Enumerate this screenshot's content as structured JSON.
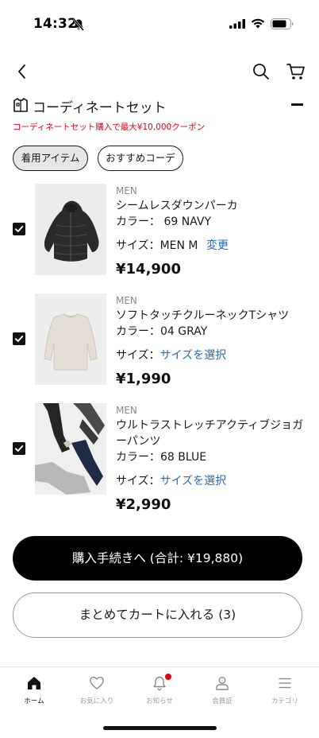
{
  "status_bar": {
    "time": "14:32"
  },
  "section": {
    "title": "コーディネートセット",
    "coupon_note": "コーディネートセット購入で最大¥10,000クーポン"
  },
  "chips": [
    {
      "label": "着用アイテム",
      "active": true
    },
    {
      "label": "おすすめコーデ",
      "active": false
    }
  ],
  "items": [
    {
      "gender": "MEN",
      "name": "シームレスダウンパーカ",
      "color": "カラー： 69 NAVY",
      "size_label": "サイズ：MEN M",
      "size_action": "変更",
      "price": "¥14,900",
      "checked": true
    },
    {
      "gender": "MEN",
      "name": "ソフトタッチクルーネックTシャツ",
      "color": "カラー：04 GRAY",
      "size_label": "サイズ：",
      "size_action": "サイズを選択",
      "price": "¥1,990",
      "checked": true
    },
    {
      "gender": "MEN",
      "name": "ウルトラストレッチアクティブジョガーパンツ",
      "color": "カラー：68 BLUE",
      "size_label": "サイズ：",
      "size_action": "サイズを選択",
      "price": "¥2,990",
      "checked": true
    }
  ],
  "actions": {
    "checkout_label": "購入手続きへ (合計: ¥19,880)",
    "add_all_label": "まとめてカートに入れる (3)"
  },
  "tab_bar": [
    {
      "label": "ホーム",
      "icon": "home-icon",
      "active": true
    },
    {
      "label": "お気に入り",
      "icon": "heart-icon",
      "active": false
    },
    {
      "label": "お知らせ",
      "icon": "bell-icon",
      "active": false,
      "badge": true
    },
    {
      "label": "会員証",
      "icon": "person-icon",
      "active": false
    },
    {
      "label": "カテゴリ",
      "icon": "menu-icon",
      "active": false
    }
  ],
  "colors": {
    "accent_red": "#e60012",
    "link_blue": "#2a6ab7",
    "primary_black": "#000000"
  }
}
